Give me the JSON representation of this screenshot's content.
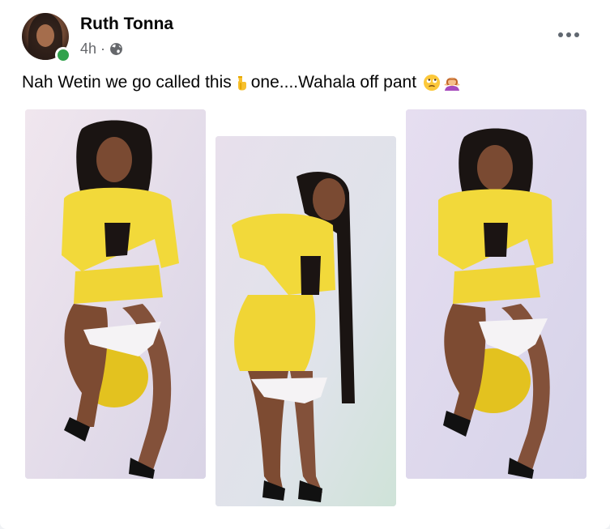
{
  "post": {
    "author": "Ruth Tonna",
    "time": "4h",
    "dot": "·",
    "audience_icon": "globe-icon",
    "more_icon": "more-horizontal-icon",
    "caption_parts": {
      "before_emoji": "Nah Wetin we go called this",
      "after_emoji": "one....Wahala off pant"
    },
    "emojis": [
      "pointing-down-emoji",
      "eye-roll-emoji",
      "woman-shrugging-emoji"
    ],
    "photos": [
      {
        "id": "photo-1",
        "subject": "woman in yellow outfit seated on yellow stool"
      },
      {
        "id": "photo-2",
        "subject": "woman in yellow outfit standing, bending forward"
      },
      {
        "id": "photo-3",
        "subject": "woman in yellow outfit seated on yellow stool"
      }
    ]
  },
  "colors": {
    "online": "#31a24c",
    "text_primary": "#050505",
    "text_secondary": "#65676b",
    "outfit": "#f2d93a"
  }
}
